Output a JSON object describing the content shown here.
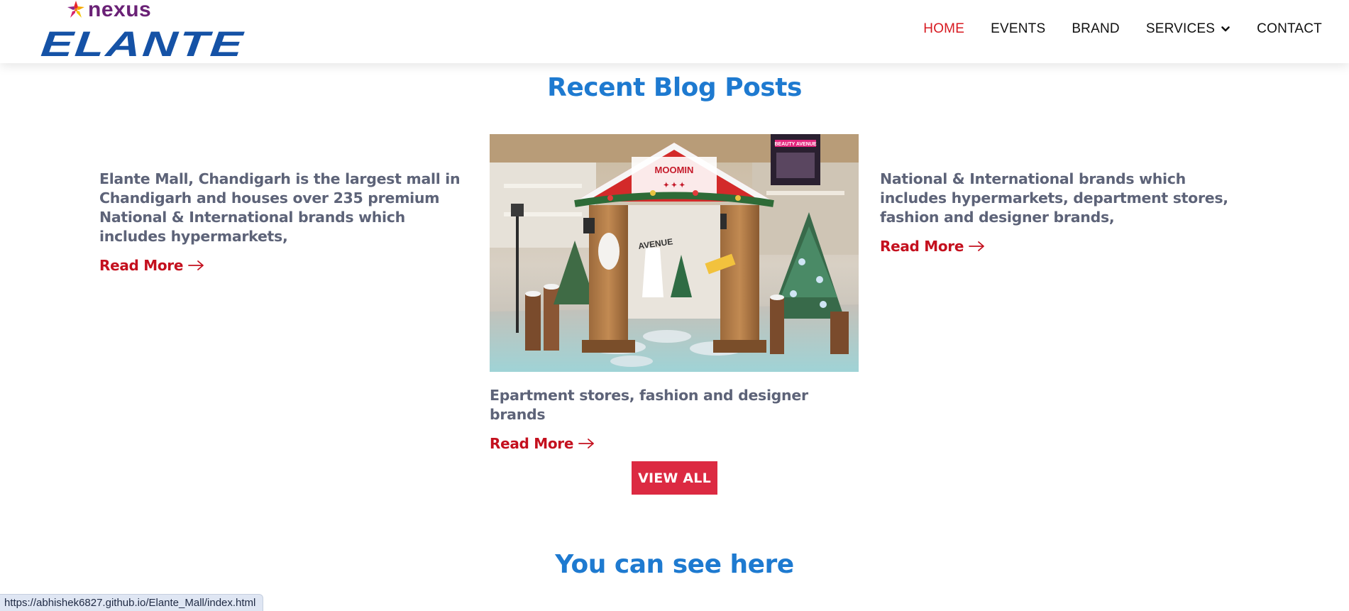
{
  "header": {
    "logo_brand": "nexus",
    "logo_name": "ELANTE",
    "nav": [
      {
        "label": "HOME",
        "active": true
      },
      {
        "label": "EVENTS",
        "active": false
      },
      {
        "label": "BRAND",
        "active": false
      },
      {
        "label": "SERVICES",
        "active": false,
        "has_dropdown": true
      },
      {
        "label": "CONTACT",
        "active": false
      }
    ]
  },
  "blog": {
    "title": "Recent Blog Posts",
    "posts": [
      {
        "text": "Elante Mall, Chandigarh is the largest mall in Chandigarh and houses over 235 premium National & International brands which includes hypermarkets,",
        "read_more": "Read More"
      },
      {
        "text": "Epartment stores, fashion and designer brands",
        "read_more": "Read More",
        "image": "christmas-mall-decoration-image",
        "image_signs": {
          "top": "MOOMIN",
          "side": "BEAUTY AVENUE",
          "pillar": "AVENUE"
        }
      },
      {
        "text": "National & International brands which includes hypermarkets, department stores, fashion and designer brands,",
        "read_more": "Read More"
      }
    ],
    "view_all": "VIEW ALL"
  },
  "second_section": {
    "title": "You can see here"
  },
  "status_bar": {
    "url": "https://abhishek6827.github.io/Elante_Mall/index.html"
  },
  "colors": {
    "accent_red": "#c4101e",
    "button_red": "#dc2a42",
    "title_blue": "#1e7ad0",
    "logo_blue": "#1552a6",
    "logo_purple": "#6a2176",
    "text_gray": "#5d6378"
  },
  "icons": {
    "nav_dropdown": "chevron-down-icon",
    "read_more": "arrow-right-icon",
    "logo": "star-flower-icon"
  }
}
